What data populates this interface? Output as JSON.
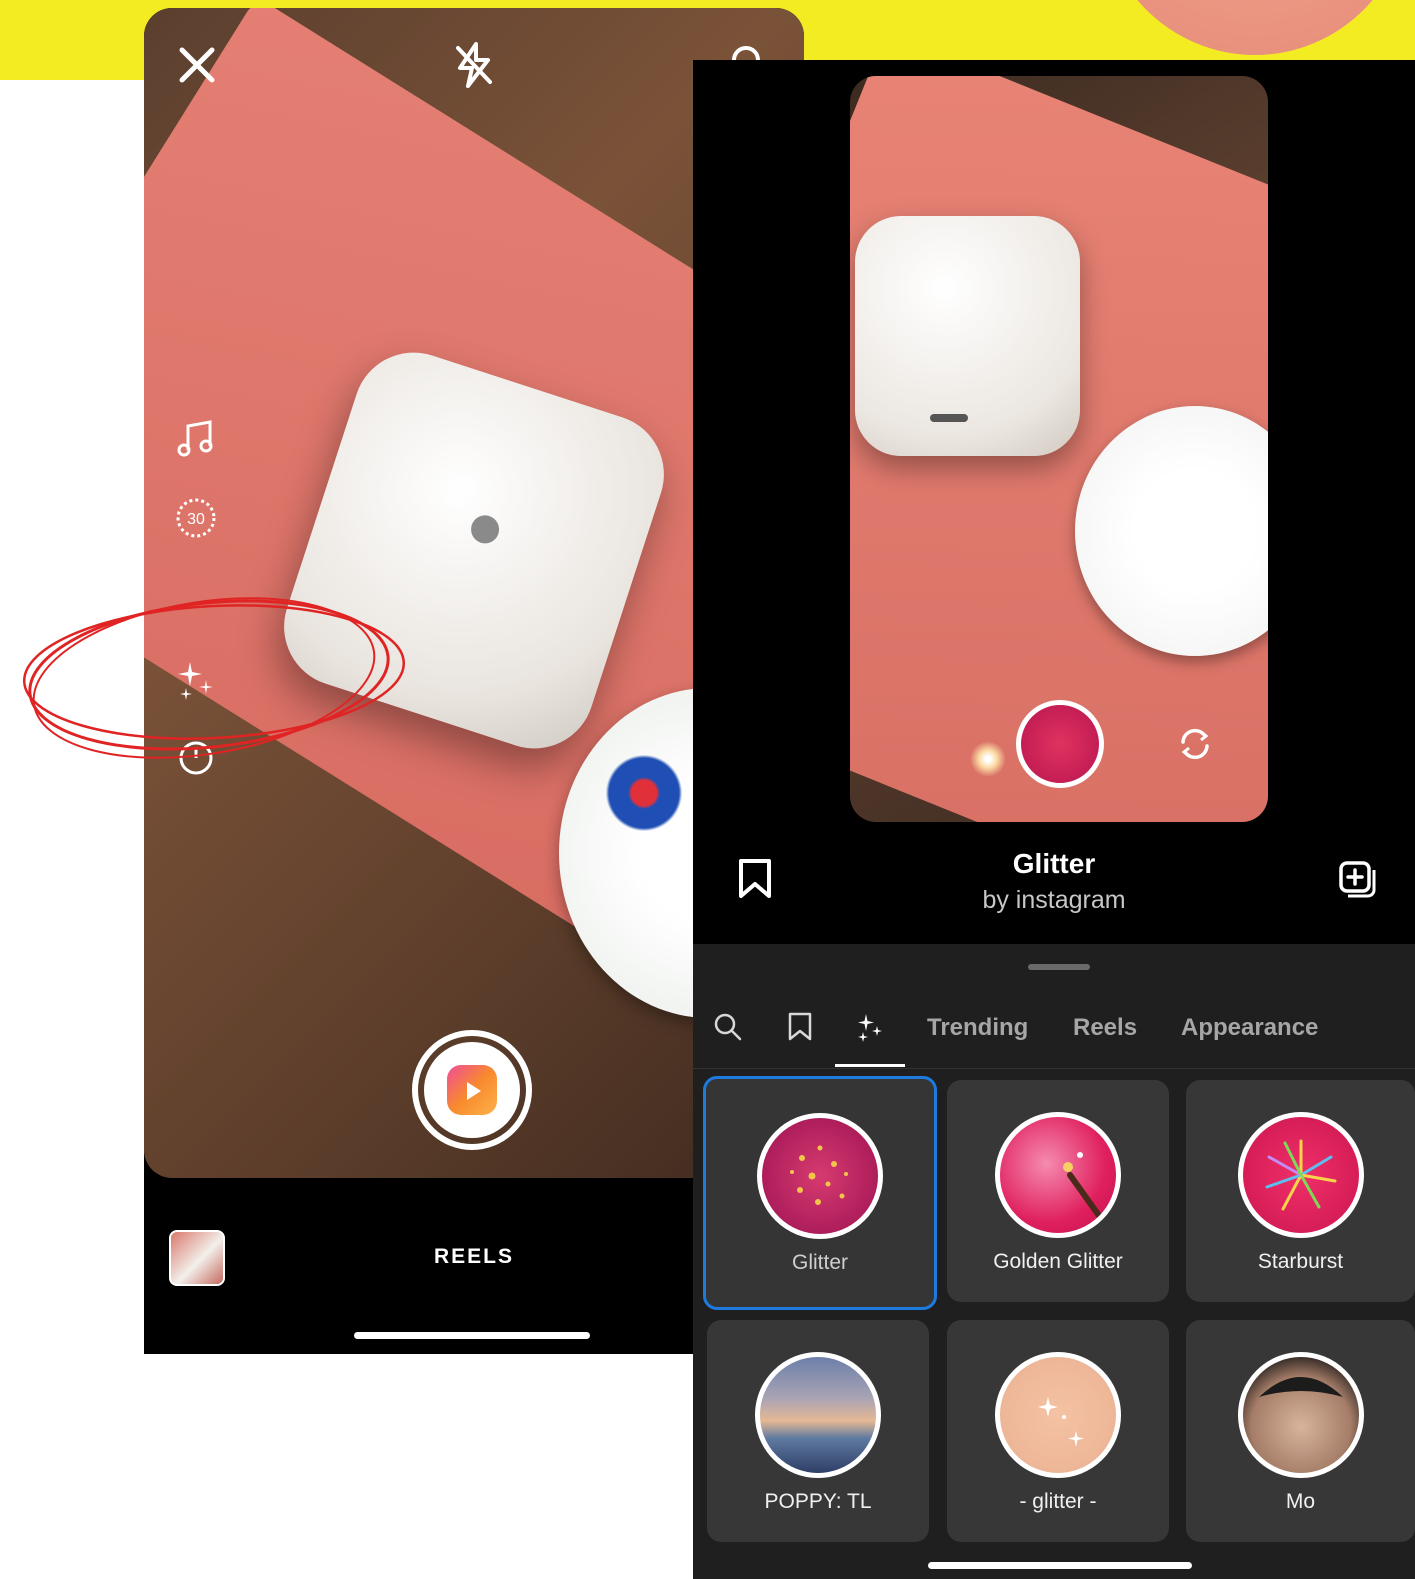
{
  "reels_camera": {
    "mode_label": "REELS",
    "timer_value": "30",
    "close_icon": "close-icon",
    "flash_icon": "flash-off-icon",
    "settings_icon": "gear-icon"
  },
  "effect_preview": {
    "title": "Glitter",
    "author": "by instagram"
  },
  "effects_tabs": {
    "trending": "Trending",
    "reels": "Reels",
    "appearance": "Appearance"
  },
  "effects": [
    {
      "label": "Glitter"
    },
    {
      "label": "Golden Glitter"
    },
    {
      "label": "Starburst"
    },
    {
      "label": "POPPY: TL"
    },
    {
      "label": "- glitter -"
    },
    {
      "label": "Mo"
    }
  ],
  "colors": {
    "accent_yellow": "#f4ec22",
    "selection_blue": "#1d7be0",
    "annotation_red": "#e02424"
  }
}
